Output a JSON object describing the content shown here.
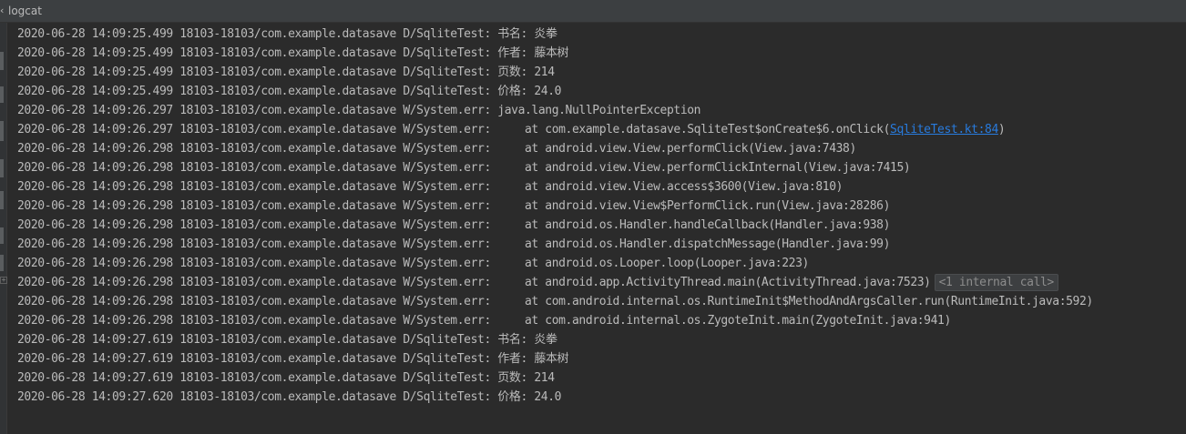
{
  "window": {
    "title": "logcat"
  },
  "log": {
    "lines": [
      {
        "text": "2020-06-28 14:09:25.499 18103-18103/com.example.datasave D/SqliteTest: 书名: 炎拳"
      },
      {
        "text": "2020-06-28 14:09:25.499 18103-18103/com.example.datasave D/SqliteTest: 作者: 藤本树"
      },
      {
        "text": "2020-06-28 14:09:25.499 18103-18103/com.example.datasave D/SqliteTest: 页数: 214"
      },
      {
        "text": "2020-06-28 14:09:25.499 18103-18103/com.example.datasave D/SqliteTest: 价格: 24.0"
      },
      {
        "text": "2020-06-28 14:09:26.297 18103-18103/com.example.datasave W/System.err: java.lang.NullPointerException"
      },
      {
        "text": "2020-06-28 14:09:26.297 18103-18103/com.example.datasave W/System.err:     at com.example.datasave.SqliteTest$onCreate$6.onClick(",
        "link": "SqliteTest.kt:84",
        "suffix": ")"
      },
      {
        "text": "2020-06-28 14:09:26.298 18103-18103/com.example.datasave W/System.err:     at android.view.View.performClick(View.java:7438)"
      },
      {
        "text": "2020-06-28 14:09:26.298 18103-18103/com.example.datasave W/System.err:     at android.view.View.performClickInternal(View.java:7415)"
      },
      {
        "text": "2020-06-28 14:09:26.298 18103-18103/com.example.datasave W/System.err:     at android.view.View.access$3600(View.java:810)"
      },
      {
        "text": "2020-06-28 14:09:26.298 18103-18103/com.example.datasave W/System.err:     at android.view.View$PerformClick.run(View.java:28286)"
      },
      {
        "text": "2020-06-28 14:09:26.298 18103-18103/com.example.datasave W/System.err:     at android.os.Handler.handleCallback(Handler.java:938)"
      },
      {
        "text": "2020-06-28 14:09:26.298 18103-18103/com.example.datasave W/System.err:     at android.os.Handler.dispatchMessage(Handler.java:99)"
      },
      {
        "text": "2020-06-28 14:09:26.298 18103-18103/com.example.datasave W/System.err:     at android.os.Looper.loop(Looper.java:223)"
      },
      {
        "text": "2020-06-28 14:09:26.298 18103-18103/com.example.datasave W/System.err:     at android.app.ActivityThread.main(ActivityThread.java:7523)",
        "badge": "<1 internal call>"
      },
      {
        "text": "2020-06-28 14:09:26.298 18103-18103/com.example.datasave W/System.err:     at com.android.internal.os.RuntimeInit$MethodAndArgsCaller.run(RuntimeInit.java:592)"
      },
      {
        "text": "2020-06-28 14:09:26.298 18103-18103/com.example.datasave W/System.err:     at com.android.internal.os.ZygoteInit.main(ZygoteInit.java:941)"
      },
      {
        "text": "2020-06-28 14:09:27.619 18103-18103/com.example.datasave D/SqliteTest: 书名: 炎拳"
      },
      {
        "text": "2020-06-28 14:09:27.619 18103-18103/com.example.datasave D/SqliteTest: 作者: 藤本树"
      },
      {
        "text": "2020-06-28 14:09:27.619 18103-18103/com.example.datasave D/SqliteTest: 页数: 214"
      },
      {
        "text": "2020-06-28 14:09:27.620 18103-18103/com.example.datasave D/SqliteTest: 价格: 24.0"
      }
    ]
  },
  "colors": {
    "background": "#2b2b2b",
    "text": "#bbbbbb",
    "link": "#287bde"
  }
}
